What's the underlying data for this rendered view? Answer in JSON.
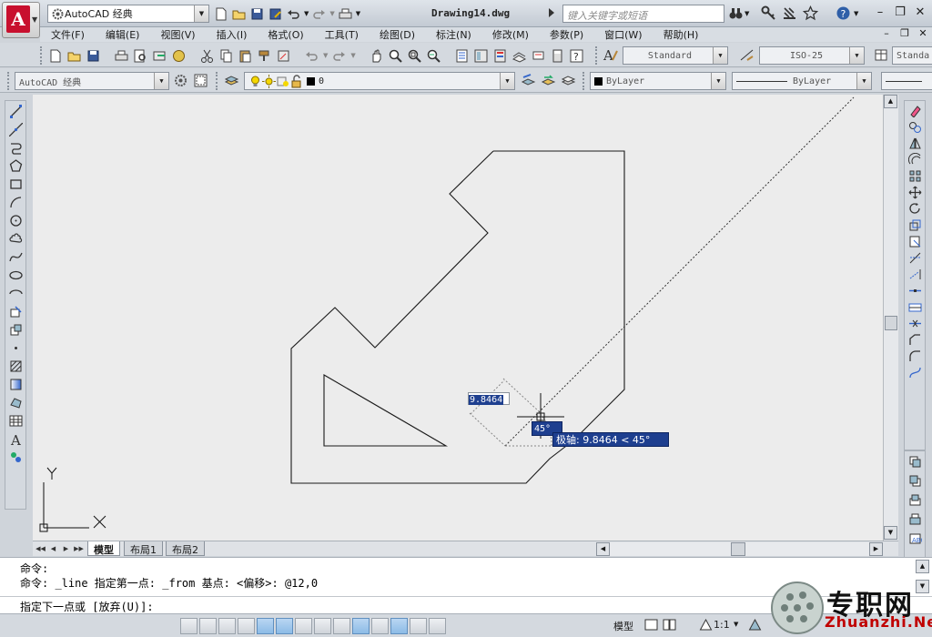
{
  "title_bar": {
    "workspace": "AutoCAD 经典",
    "document_title": "Drawing14.dwg",
    "search_placeholder": "键入关键字或短语"
  },
  "menu": {
    "items": [
      "文件(F)",
      "编辑(E)",
      "视图(V)",
      "插入(I)",
      "格式(O)",
      "工具(T)",
      "绘图(D)",
      "标注(N)",
      "修改(M)",
      "参数(P)",
      "窗口(W)",
      "帮助(H)"
    ]
  },
  "toolbar1": {
    "text_style": "Standard",
    "dim_style": "ISO-25",
    "table_style": "Standa"
  },
  "toolbar2": {
    "workspace": "AutoCAD 经典",
    "layer": "0",
    "color": "ByLayer",
    "linetype": "ByLayer"
  },
  "canvas": {
    "axis_y": "Y",
    "axis_x": "X",
    "dynamic_input": "9.8464",
    "angle_tip": "45°",
    "polar_tip": "极轴: 9.8464 < 45°"
  },
  "tabs": [
    "模型",
    "布局1",
    "布局2"
  ],
  "command": {
    "history": [
      "命令:",
      "命令: _line 指定第一点: _from 基点: <偏移>: @12,0"
    ],
    "prompt": "指定下一点或 [放弃(U)]:"
  },
  "status": {
    "model_label": "模型",
    "scale": "1:1"
  },
  "watermark": {
    "text": "专职网",
    "url": "Zhuanzhi.Net"
  },
  "colors": {
    "accent_red": "#c8102e",
    "tooltip_blue": "#1e3f8f",
    "canvas_bg": "#ececec"
  }
}
